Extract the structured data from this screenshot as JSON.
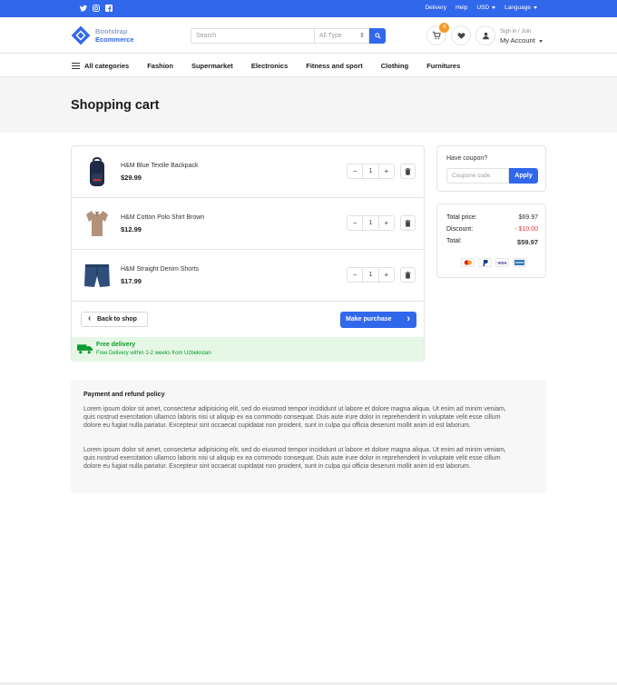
{
  "topbar": {
    "social": [
      "twitter-icon",
      "instagram-icon",
      "facebook-icon"
    ],
    "links": [
      "Delivery",
      "Help"
    ],
    "currency": "USD",
    "language": "Language"
  },
  "header": {
    "logo_line1": "Bootstrap",
    "logo_line2": "Ecommerce",
    "search_placeholder": "Search",
    "type_select": "All Type",
    "cart_count": "4",
    "account_small": "Sign in / Join",
    "account_big": "My Account"
  },
  "categories": [
    "All categories",
    "Fashion",
    "Supermarket",
    "Electronics",
    "Fitness and sport",
    "Clothing",
    "Furnitures"
  ],
  "page_title": "Shopping cart",
  "cart": {
    "items": [
      {
        "name": "H&M Blue Textile Backpack",
        "price": "$29.99",
        "qty": "1"
      },
      {
        "name": "H&M Cotton Polo Shirt Brown",
        "price": "$12.99",
        "qty": "1"
      },
      {
        "name": "H&M Straight Denim Shorts",
        "price": "$17.99",
        "qty": "1"
      }
    ],
    "back_label": "Back to shop",
    "purchase_label": "Make purchase",
    "delivery_title": "Free delivery",
    "delivery_text": "Free Delivery within 1-2 weeks from Uzbekistan"
  },
  "coupon": {
    "label": "Have coupon?",
    "placeholder": "Coupone code",
    "apply": "Apply"
  },
  "totals": {
    "price_label": "Total price:",
    "price": "$69.97",
    "discount_label": "Discount:",
    "discount": "- $10.00",
    "total_label": "Total:",
    "total": "$59.97",
    "payments": [
      "mastercard-icon",
      "paypal-icon",
      "visa-icon",
      "amex-icon"
    ]
  },
  "policy": {
    "title": "Payment and refund policy",
    "p1": "Lorem ipsum dolor sit amet, consectetur adipisicing elit, sed do eiusmod tempor incididunt ut labore et dolore magna aliqua. Ut enim ad minim veniam, quis nostrud exercitation ullamco laboris nisi ut aliquip ex ea commodo consequat. Duis aute irure dolor in reprehenderit in voluptate velit esse cillum dolore eu fugiat nulla pariatur. Excepteur sint occaecat cupidatat non proident, sunt in culpa qui officia deserunt mollit anim id est laborum.",
    "p2": "Lorem ipsum dolor sit amet, consectetur adipisicing elit, sed do eiusmod tempor incididunt ut labore et dolore magna aliqua. Ut enim ad minim veniam, quis nostrud exercitation ullamco laboris nisi ut aliquip ex ea commodo consequat. Duis aute irure dolor in reprehenderit in voluptate velit esse cillum dolore eu fugiat nulla pariatur. Excepteur sint occaecat cupidatat non proident, sunt in culpa qui officia deserunt mollit anim id est laborum."
  },
  "colors": {
    "primary": "#3167eb",
    "badge": "#f39b2c",
    "success": "#0c9b2f",
    "danger": "#e53935"
  }
}
